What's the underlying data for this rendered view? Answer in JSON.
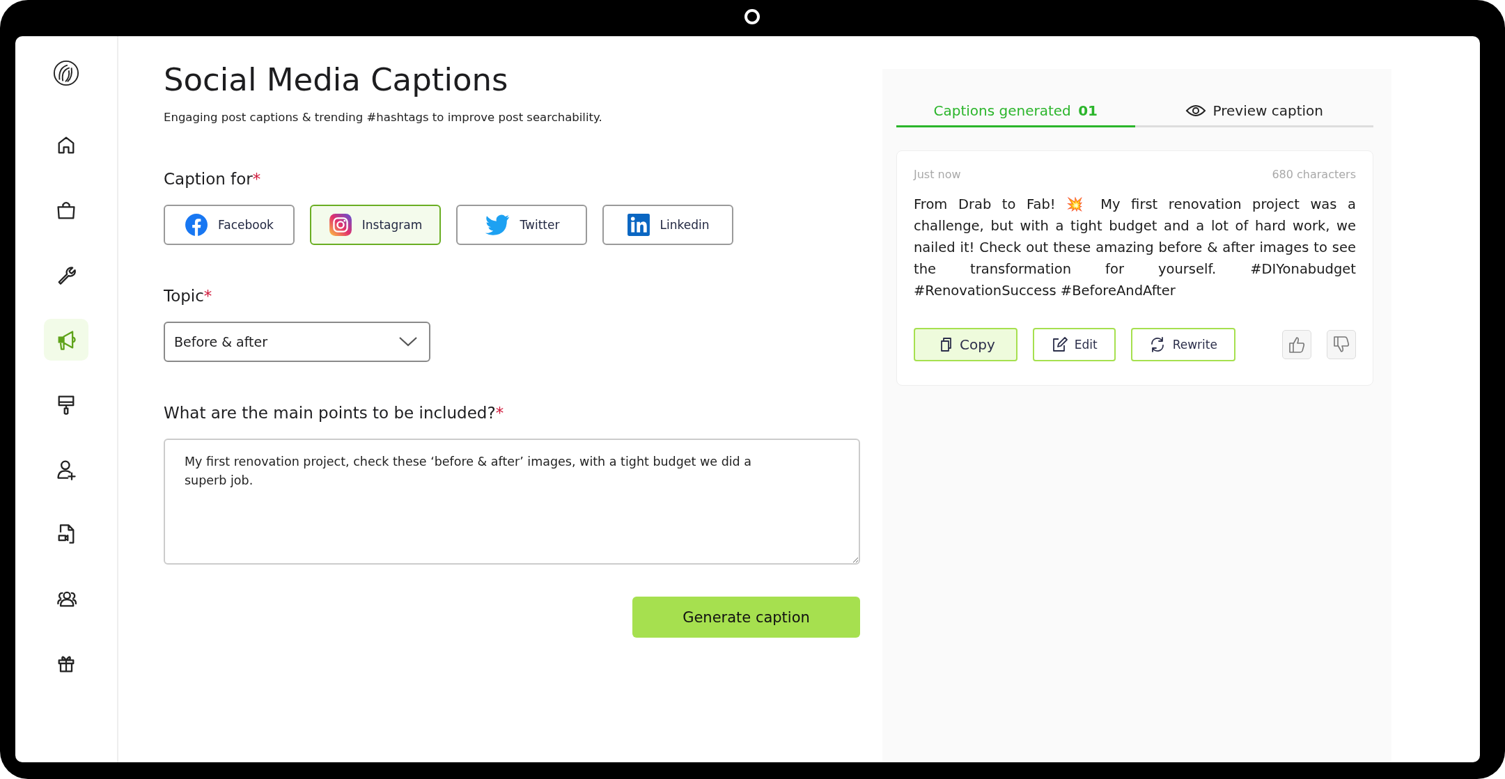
{
  "sidebar": {
    "items": [
      {
        "kind": "home",
        "selected": false
      },
      {
        "kind": "bag",
        "selected": false
      },
      {
        "kind": "wrench",
        "selected": false
      },
      {
        "kind": "megaphone",
        "selected": true
      },
      {
        "kind": "roller",
        "selected": false
      },
      {
        "kind": "user-plus",
        "selected": false
      },
      {
        "kind": "video-file",
        "selected": false
      },
      {
        "kind": "users",
        "selected": false
      },
      {
        "kind": "gift",
        "selected": false
      }
    ]
  },
  "header": {
    "title": "Social Media Captions",
    "subtitle": "Engaging post captions & trending #hashtags to improve post searchability."
  },
  "caption_for": {
    "label": "Caption for",
    "required_mark": "*",
    "platforms": [
      {
        "kind": "facebook",
        "label": "Facebook",
        "selected": false
      },
      {
        "kind": "instagram",
        "label": "Instagram",
        "selected": true
      },
      {
        "kind": "twitter",
        "label": "Twitter",
        "selected": false
      },
      {
        "kind": "linkedin",
        "label": "Linkedin",
        "selected": false
      }
    ]
  },
  "topic": {
    "label": "Topic",
    "required_mark": "*",
    "value": "Before & after"
  },
  "main_points": {
    "label": "What are the main points to be included?",
    "required_mark": "*",
    "value": "My first renovation project, check these ‘before & after’ images, with a tight budget we did a superb job."
  },
  "generate_button": "Generate caption",
  "results": {
    "tabs": [
      {
        "kind": "count",
        "label": "Captions generated",
        "count": "01",
        "selected": true
      },
      {
        "kind": "preview",
        "label": "Preview caption",
        "selected": false
      }
    ],
    "captions": [
      {
        "time": "Just now",
        "characters": "680 characters",
        "text": "From Drab to Fab! 💥 My first renovation project was a challenge, but with a tight budget and a lot of hard work, we nailed it! Check out these amazing before & after images to see the transformation for yourself. #DIYonabudget #RenovationSuccess #BeforeAndAfter",
        "actions": [
          {
            "kind": "copy",
            "label": "Copy",
            "highlighted": true
          },
          {
            "kind": "edit",
            "label": "Edit",
            "highlighted": false
          },
          {
            "kind": "rewrite",
            "label": "Rewrite",
            "highlighted": false
          }
        ]
      }
    ]
  }
}
